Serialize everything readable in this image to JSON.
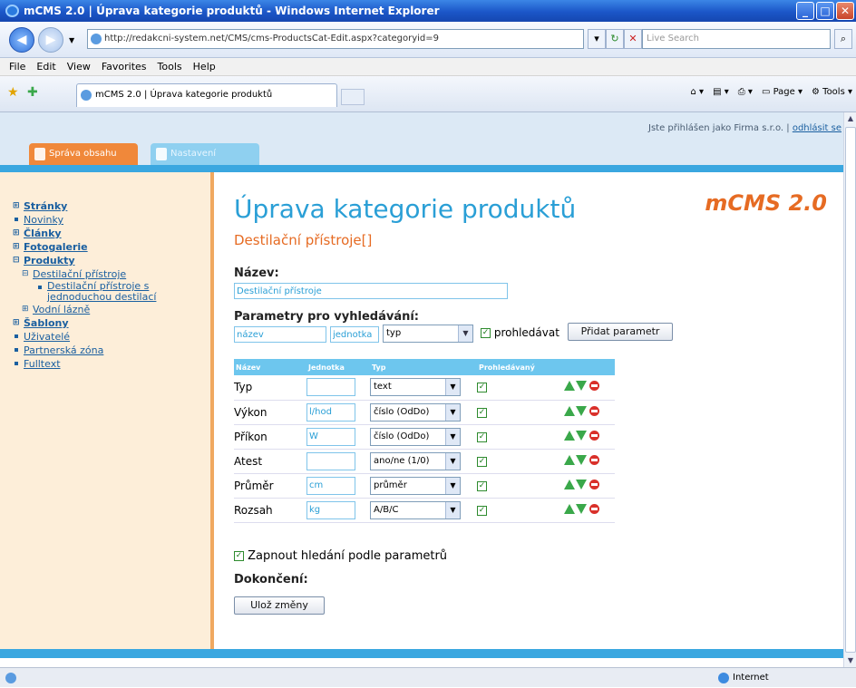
{
  "window": {
    "title": "mCMS 2.0 | Úprava kategorie produktů - Windows Internet Explorer",
    "address": "http://redakcni-system.net/CMS/cms-ProductsCat-Edit.aspx?categoryid=9",
    "search_placeholder": "Live Search",
    "menu": [
      "File",
      "Edit",
      "View",
      "Favorites",
      "Tools",
      "Help"
    ],
    "tab_title": "mCMS 2.0 | Úprava kategorie produktů",
    "toolbar_right": [
      "Page",
      "Tools"
    ]
  },
  "header": {
    "login_text": "Jste přihlášen jako Firma s.r.o. |",
    "logout_link": "odhlásit se",
    "tabs": [
      "Správa obsahu",
      "Nastavení"
    ]
  },
  "sidebar": {
    "items": [
      {
        "label": "Stránky",
        "bold": true,
        "mark": "+"
      },
      {
        "label": "Novinky",
        "bold": false,
        "mark": "bullet"
      },
      {
        "label": "Články",
        "bold": true,
        "mark": "+"
      },
      {
        "label": "Fotogalerie",
        "bold": true,
        "mark": "+"
      },
      {
        "label": "Produkty",
        "bold": true,
        "mark": "−"
      },
      {
        "label": "Destilační přístroje",
        "level": 1,
        "mark": "−"
      },
      {
        "label": "Destilační přístroje s jednoduchou destilací",
        "level": 2,
        "mark": "bullet"
      },
      {
        "label": "Vodní lázně",
        "level": 1,
        "mark": "+"
      },
      {
        "label": "Šablony",
        "bold": true,
        "mark": "+"
      },
      {
        "label": "Uživatelé",
        "bold": false,
        "mark": "bullet"
      },
      {
        "label": "Partnerská zóna",
        "bold": false,
        "mark": "bullet"
      },
      {
        "label": "Fulltext",
        "bold": false,
        "mark": "bullet"
      }
    ]
  },
  "main": {
    "brand": "mCMS 2.0",
    "title": "Úprava kategorie produktů",
    "subtitle": "Destilační přístroje[]",
    "name_label": "Název:",
    "name_value": "Destilační přístroje",
    "params_label": "Parametry pro vyhledávání:",
    "new_param": {
      "name_placeholder": "název",
      "unit_placeholder": "jednotka",
      "type_value": "typ",
      "search_label": "prohledávat",
      "add_button": "Přidat parametr"
    },
    "table_headers": [
      "Název",
      "Jednotka",
      "Typ",
      "Prohledávaný"
    ],
    "rows": [
      {
        "name": "Typ",
        "unit": "",
        "type": "text",
        "searchable": true
      },
      {
        "name": "Výkon",
        "unit": "l/hod",
        "type": "číslo (OdDo)",
        "searchable": true
      },
      {
        "name": "Příkon",
        "unit": "W",
        "type": "číslo (OdDo)",
        "searchable": true
      },
      {
        "name": "Atest",
        "unit": "",
        "type": "ano/ne (1/0)",
        "searchable": true
      },
      {
        "name": "Průměr",
        "unit": "cm",
        "type": "průměr",
        "searchable": true
      },
      {
        "name": "Rozsah",
        "unit": "kg",
        "type": "A/B/C",
        "searchable": true
      }
    ],
    "enable_search_label": "Zapnout hledání podle parametrů",
    "finish_label": "Dokončení:",
    "save_button": "Ulož změny"
  },
  "status": {
    "zone": "Internet"
  }
}
